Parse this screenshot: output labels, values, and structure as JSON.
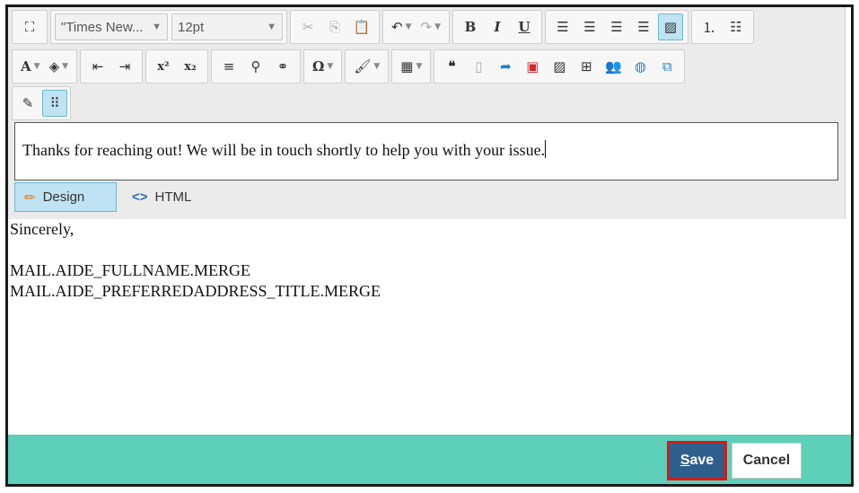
{
  "toolbar": {
    "font_family": "\"Times New...",
    "font_size": "12pt",
    "bold": "B",
    "italic": "I",
    "underline": "U",
    "font_color": "A",
    "superscript": "x²",
    "subscript": "x₂",
    "special_char": "Ω",
    "quote": "❝"
  },
  "editor": {
    "body_text": "Thanks for reaching out! We will be in touch shortly to help you with your issue."
  },
  "modes": {
    "design": "Design",
    "html": "HTML"
  },
  "signature": {
    "closing": "Sincerely,",
    "line1": "MAIL.AIDE_FULLNAME.MERGE",
    "line2": "MAIL.AIDE_PREFERREDADDRESS_TITLE.MERGE"
  },
  "footer": {
    "save_access_key": "S",
    "save_rest": "ave",
    "cancel": "Cancel"
  },
  "colors": {
    "footer_bg": "#5ecfb9",
    "save_bg": "#2e5f8c",
    "save_highlight": "#d61a1a",
    "active_tool": "#bfe3f2"
  }
}
